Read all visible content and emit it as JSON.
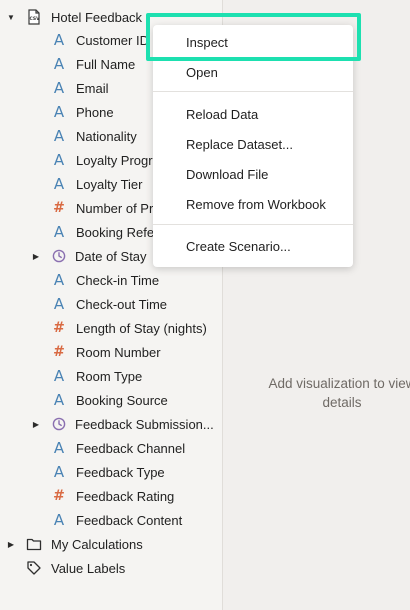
{
  "tree": {
    "dataset": {
      "label": "Hotel Feedback",
      "icon": "csv-file-icon",
      "expanded": true
    },
    "columns": [
      {
        "label": "Customer ID",
        "type": "text"
      },
      {
        "label": "Full Name",
        "type": "text"
      },
      {
        "label": "Email",
        "type": "text"
      },
      {
        "label": "Phone",
        "type": "text"
      },
      {
        "label": "Nationality",
        "type": "text"
      },
      {
        "label": "Loyalty Progra",
        "type": "text"
      },
      {
        "label": "Loyalty Tier",
        "type": "text"
      },
      {
        "label": "Number of Pre",
        "type": "number"
      },
      {
        "label": "Booking Refer",
        "type": "text"
      },
      {
        "label": "Date of Stay",
        "type": "date"
      },
      {
        "label": "Check-in Time",
        "type": "text"
      },
      {
        "label": "Check-out Time",
        "type": "text"
      },
      {
        "label": "Length of Stay (nights)",
        "type": "number"
      },
      {
        "label": "Room Number",
        "type": "number"
      },
      {
        "label": "Room Type",
        "type": "text"
      },
      {
        "label": "Booking Source",
        "type": "text"
      },
      {
        "label": "Feedback Submission...",
        "type": "date"
      },
      {
        "label": "Feedback Channel",
        "type": "text"
      },
      {
        "label": "Feedback Type",
        "type": "text"
      },
      {
        "label": "Feedback Rating",
        "type": "number"
      },
      {
        "label": "Feedback Content",
        "type": "text"
      }
    ],
    "my_calculations": {
      "label": "My Calculations",
      "icon": "folder-icon"
    },
    "value_labels": {
      "label": "Value Labels",
      "icon": "tag-icon"
    }
  },
  "context_menu": {
    "inspect": "Inspect",
    "open": "Open",
    "reload": "Reload Data",
    "replace": "Replace Dataset...",
    "download": "Download File",
    "remove": "Remove from Workbook",
    "scenario": "Create Scenario..."
  },
  "canvas": {
    "empty_message_line1": "Add visualization to view",
    "empty_message_line2": "details"
  },
  "colors": {
    "text_icon": "#4a83b4",
    "number_icon": "#d96a43",
    "date_icon": "#8a6fb0",
    "highlight": "#1de0b0"
  }
}
